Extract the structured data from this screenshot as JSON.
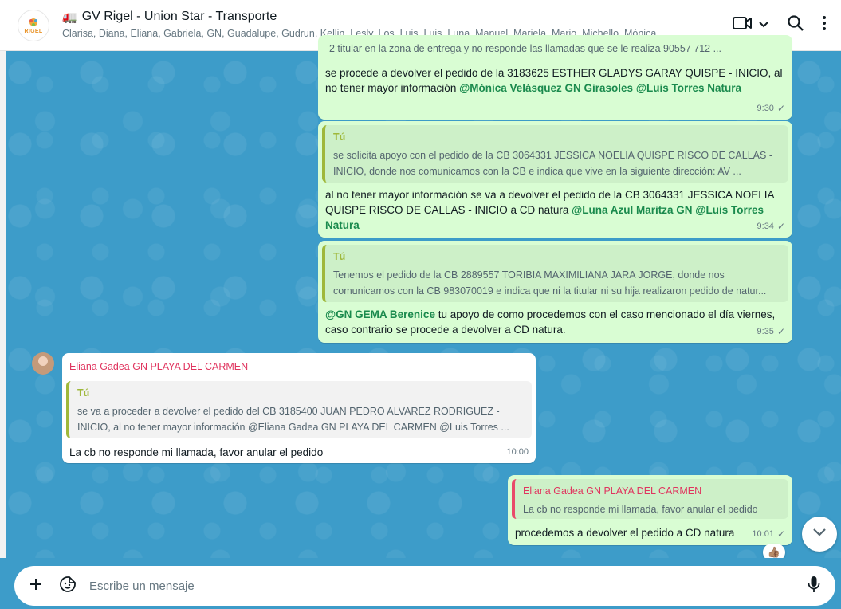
{
  "header": {
    "avatar_logo_text": "RIGEL",
    "title_emoji": "🚛",
    "title": "GV Rigel - Union Star - Transporte",
    "members": "Clarisa, Diana, Eliana, Gabriela, GN, Guadalupe, Gudrun, Kellin, Lesly, Los, Luis, Luis, Luna, Manuel, Mariela, Mario, Michello, Mónica, R..."
  },
  "messages": [
    {
      "top_partial": "2 titular en la zona de entrega y no responde las llamadas que se le realiza 90557 712 ...",
      "text_plain": "se procede a devolver el pedido de la  3183625 ESTHER GLADYS GARAY QUISPE - INICIO, al no tener mayor información ",
      "mention_1": "@Mónica Velásquez GN Girasoles",
      "mention_2": "@Luis Torres Natura",
      "time": "9:30"
    },
    {
      "quote_author": "Tú",
      "quote_text": "se solicita apoyo con el pedido de la CB 3064331 JESSICA NOELIA QUISPE RISCO DE CALLAS - INICIO, donde nos comunicamos con la CB e indica que vive en la siguiente dirección: AV ...",
      "text_plain": "al no tener mayor información se va a devolver el pedido de la CB 3064331 JESSICA NOELIA QUISPE RISCO DE CALLAS - INICIO a CD natura ",
      "mention_1": "@Luna Azul Maritza GN",
      "mention_2": "@Luis Torres Natura",
      "time": "9:34"
    },
    {
      "quote_author": "Tú",
      "quote_text": "Tenemos el pedido de la CB 2889557 TORIBIA MAXIMILIANA JARA JORGE, donde nos comunicamos con la CB 983070019 e indica que ni la titular ni su hija realizaron pedido de natur...",
      "mention_1": "@GN GEMA Berenice",
      "text_plain": " tu apoyo de como procedemos con el caso mencionado el día viernes, caso contrario se procede a devolver a CD natura.",
      "time": "9:35"
    },
    {
      "sender": "Eliana Gadea GN PLAYA DEL CARMEN",
      "quote_author": "Tú",
      "quote_text": "se va a proceder a devolver el pedido del CB 3185400 JUAN PEDRO ALVAREZ RODRIGUEZ - INICIO, al no tener mayor información @Eliana Gadea GN PLAYA DEL CARMEN @Luis Torres ...",
      "text": "La cb no responde  mi llamada, favor anular el pedido",
      "time": "10:00"
    },
    {
      "quote_author": "Eliana Gadea GN PLAYA DEL CARMEN",
      "quote_text": "La cb no responde  mi llamada, favor anular el pedido",
      "text": "procedemos a devolver el pedido a CD natura",
      "time": "10:01",
      "reaction": "👍🏽"
    }
  ],
  "composer": {
    "placeholder": "Escribe un mensaje"
  },
  "icons": {
    "video": "video-call-icon",
    "search": "search-icon",
    "menu": "more-options-icon",
    "add": "plus-icon",
    "sticker": "sticker-icon",
    "mic": "microphone-icon"
  },
  "colors": {
    "chat_background": "#3d9cc9",
    "outgoing_bubble": "#d9fdd3",
    "mention": "#1a8a4d",
    "sender_name": "#e0355f"
  }
}
